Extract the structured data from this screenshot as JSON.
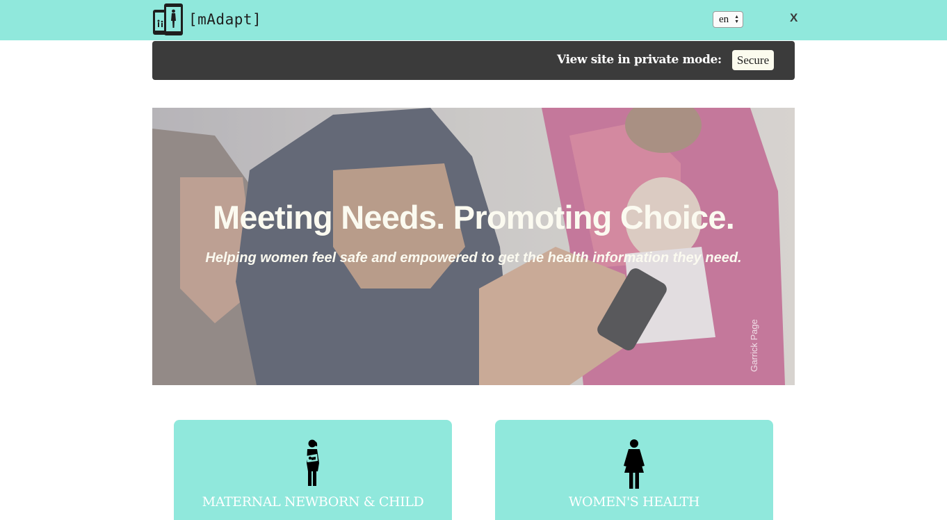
{
  "header": {
    "logo_text": "[mAdapt]",
    "language": "en",
    "close_label": "X"
  },
  "private_bar": {
    "label": "View site in private mode:",
    "button_label": "Secure"
  },
  "hero": {
    "title": "Meeting Needs. Promoting Choice.",
    "subtitle": "Helping women feel safe and empowered to get the health information they need.",
    "photo_credit": "Garrick Page"
  },
  "categories": [
    {
      "label": "MATERNAL NEWBORN & CHILD",
      "icon": "mother-with-baby-icon"
    },
    {
      "label": "WOMEN'S HEALTH",
      "icon": "woman-icon"
    }
  ],
  "colors": {
    "accent": "#90e8dc",
    "dark_bar": "#3b3b3b",
    "button_bg": "#fbfbee",
    "text_light": "#fbfaf0"
  }
}
